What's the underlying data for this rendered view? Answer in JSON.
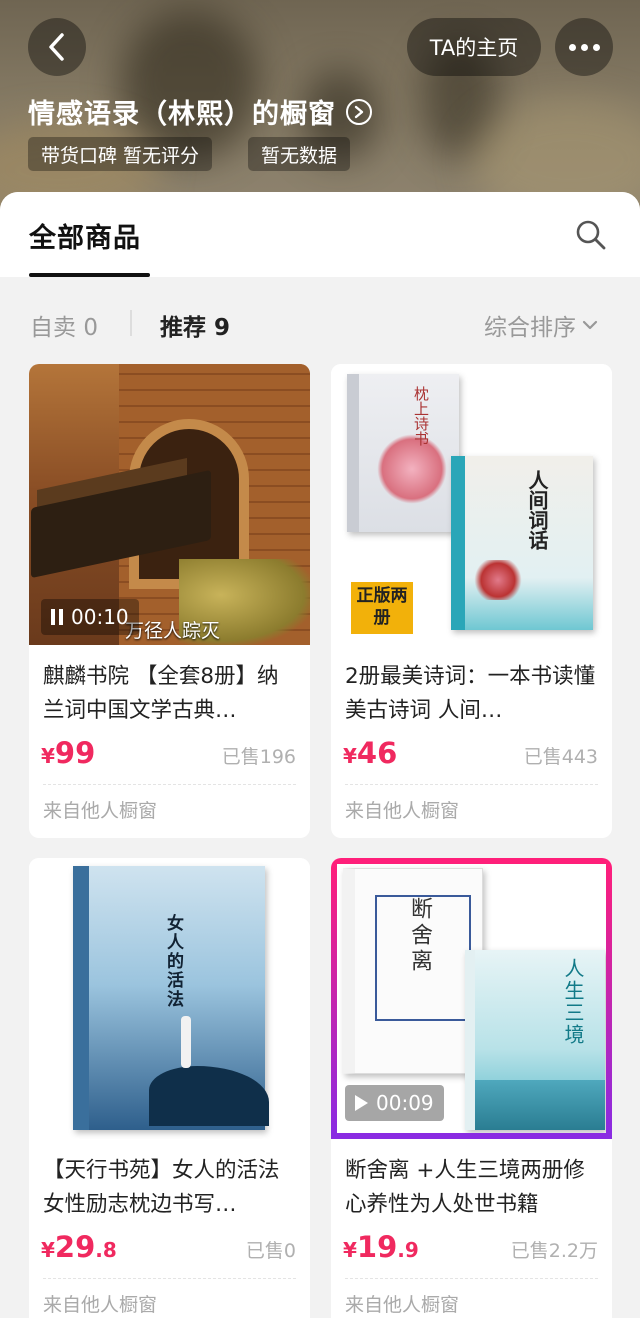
{
  "header": {
    "back_icon": "chevron-left-icon",
    "homepage_label": "TA的主页",
    "more_icon": "more-dots-icon",
    "shop_title": "情感语录（林熙）的橱窗",
    "shop_detail_icon": "chevron-right-circle-icon",
    "tags": [
      "带货口碑  暂无评分",
      "暂无数据"
    ]
  },
  "tabs": {
    "active": "全部商品",
    "search_icon": "search-icon"
  },
  "filters": {
    "self_label": "自卖",
    "self_count": "0",
    "recommend_label": "推荐",
    "recommend_count": "9",
    "sort_label": "综合排序",
    "sort_icon": "chevron-down-icon"
  },
  "products": [
    {
      "title": "麒麟书院 【全套8册】纳兰词中国文学古典…",
      "price_symbol": "¥",
      "price_int": "99",
      "price_dec": "",
      "sold": "已售196",
      "source": "来自他人橱窗",
      "video_duration": "00:10",
      "thumb_caption": "万径人踪灭"
    },
    {
      "title": "2册最美诗词：一本书读懂美古诗词 人间…",
      "price_symbol": "¥",
      "price_int": "46",
      "price_dec": "",
      "sold": "已售443",
      "source": "来自他人橱窗",
      "book_titles": [
        "枕上诗书",
        "人间词话"
      ],
      "badge": "正版两册"
    },
    {
      "title": "【天行书苑】女人的活法女性励志枕边书写…",
      "price_symbol": "¥",
      "price_int": "29",
      "price_dec": ".8",
      "sold": "已售0",
      "source": "来自他人橱窗",
      "book_titles": [
        "女人的活法"
      ]
    },
    {
      "title": "断舍离 +人生三境两册修心养性为人处世书籍",
      "price_symbol": "¥",
      "price_int": "19",
      "price_dec": ".9",
      "sold": "已售2.2万",
      "source": "来自他人橱窗",
      "video_duration": "00:09",
      "book_titles": [
        "断舍离",
        "人生三境"
      ],
      "highlight_colors": [
        "#ff1f7a",
        "#8a2be2"
      ]
    }
  ],
  "colors": {
    "price": "#f0295f",
    "muted": "#999999"
  }
}
